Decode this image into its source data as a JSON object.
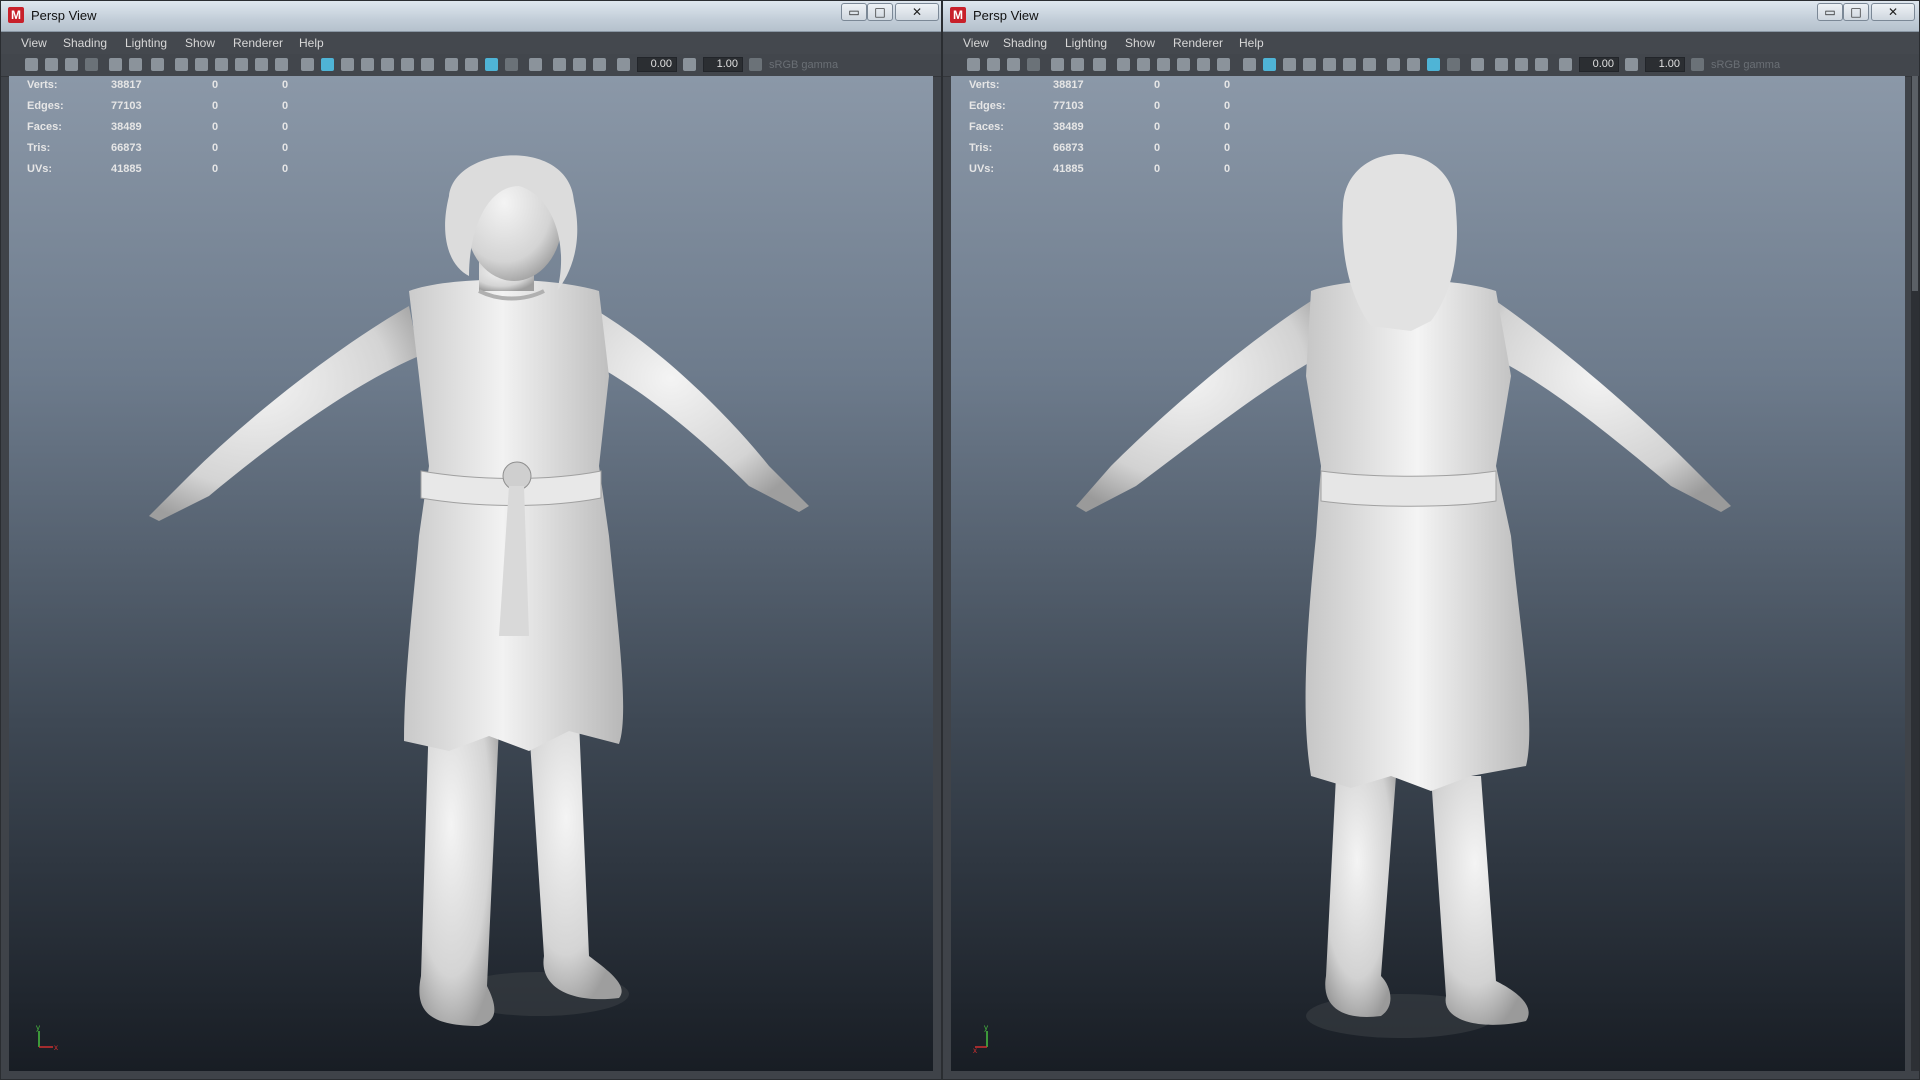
{
  "windows": [
    {
      "title": "Persp View",
      "menu": [
        "View",
        "Shading",
        "Lighting",
        "Show",
        "Renderer",
        "Help"
      ],
      "toolbar": {
        "field1": "0.00",
        "field2": "1.00",
        "gamma": "sRGB gamma"
      },
      "hud": [
        {
          "label": "Verts:",
          "value": "38817",
          "selected": "0",
          "components": "0"
        },
        {
          "label": "Edges:",
          "value": "77103",
          "selected": "0",
          "components": "0"
        },
        {
          "label": "Faces:",
          "value": "38489",
          "selected": "0",
          "components": "0"
        },
        {
          "label": "Tris:",
          "value": "66873",
          "selected": "0",
          "components": "0"
        },
        {
          "label": "UVs:",
          "value": "41885",
          "selected": "0",
          "components": "0"
        }
      ],
      "axis": {
        "y": "y",
        "x": "x"
      }
    },
    {
      "title": "Persp View",
      "menu": [
        "View",
        "Shading",
        "Lighting",
        "Show",
        "Renderer",
        "Help"
      ],
      "toolbar": {
        "field1": "0.00",
        "field2": "1.00",
        "gamma": "sRGB gamma"
      },
      "hud": [
        {
          "label": "Verts:",
          "value": "38817",
          "selected": "0",
          "components": "0"
        },
        {
          "label": "Edges:",
          "value": "77103",
          "selected": "0",
          "components": "0"
        },
        {
          "label": "Faces:",
          "value": "38489",
          "selected": "0",
          "components": "0"
        },
        {
          "label": "Tris:",
          "value": "66873",
          "selected": "0",
          "components": "0"
        },
        {
          "label": "UVs:",
          "value": "41885",
          "selected": "0",
          "components": "0"
        }
      ],
      "axis": {
        "y": "y",
        "x": "x"
      }
    }
  ],
  "window_buttons": {
    "minimize": "▭",
    "maximize": "□",
    "close": "✕"
  },
  "app_icon_letter": "M",
  "colors": {
    "viewport_top": "#8b98a8",
    "viewport_bottom": "#181d24",
    "accent": "#4fb4d6",
    "app_icon": "#c8202a"
  }
}
